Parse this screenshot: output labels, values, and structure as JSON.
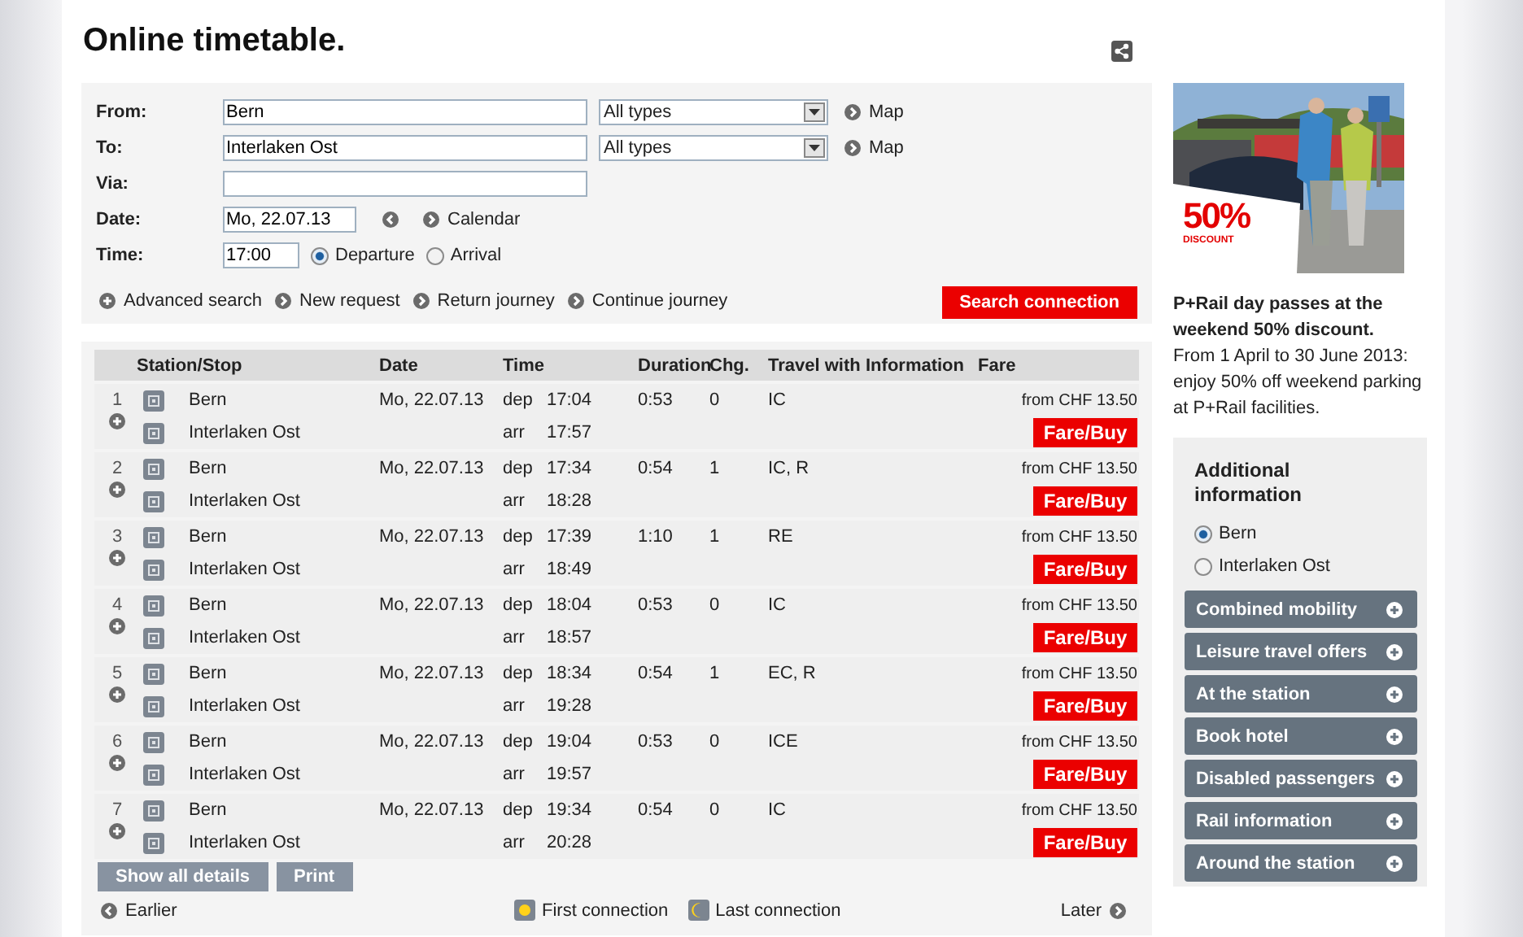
{
  "title": "Online timetable.",
  "from": {
    "label": "From:",
    "value": "Bern",
    "select": "All types",
    "map_link": "Map"
  },
  "to": {
    "label": "To:",
    "value": "Interlaken Ost",
    "select": "All types",
    "map_link": "Map"
  },
  "via": {
    "label": "Via:"
  },
  "date": {
    "label": "Date:",
    "value": "Mo, 22.07.13",
    "calendar_link": "Calendar"
  },
  "time": {
    "label": "Time:",
    "value": "17:00",
    "options": [
      {
        "label": "Departure",
        "selected": true
      },
      {
        "label": "Arrival",
        "selected": false
      }
    ]
  },
  "links": [
    "Advanced search",
    "New request",
    "Return journey",
    "Continue journey"
  ],
  "search_button": "Search connection",
  "table": {
    "columns": [
      "Station/Stop",
      "Date",
      "Time",
      "Duration",
      "Chg.",
      "Travel with",
      "Information",
      "Fare"
    ],
    "rows": [
      {
        "number": "1",
        "from": "Bern",
        "to": "Interlaken Ost",
        "date": "Mo, 22.07.13",
        "dep_label": "dep",
        "dep": "17:04",
        "arr_label": "arr",
        "arr": "17:57",
        "duration": "0:53",
        "changes": "0",
        "travel_with": "IC",
        "fare": "from CHF 13.50",
        "buy": "Fare/Buy"
      },
      {
        "number": "2",
        "from": "Bern",
        "to": "Interlaken Ost",
        "date": "Mo, 22.07.13",
        "dep_label": "dep",
        "dep": "17:34",
        "arr_label": "arr",
        "arr": "18:28",
        "duration": "0:54",
        "changes": "1",
        "travel_with": "IC, R",
        "fare": "from CHF 13.50",
        "buy": "Fare/Buy"
      },
      {
        "number": "3",
        "from": "Bern",
        "to": "Interlaken Ost",
        "date": "Mo, 22.07.13",
        "dep_label": "dep",
        "dep": "17:39",
        "arr_label": "arr",
        "arr": "18:49",
        "duration": "1:10",
        "changes": "1",
        "travel_with": "RE",
        "fare": "from CHF 13.50",
        "buy": "Fare/Buy"
      },
      {
        "number": "4",
        "from": "Bern",
        "to": "Interlaken Ost",
        "date": "Mo, 22.07.13",
        "dep_label": "dep",
        "dep": "18:04",
        "arr_label": "arr",
        "arr": "18:57",
        "duration": "0:53",
        "changes": "0",
        "travel_with": "IC",
        "fare": "from CHF 13.50",
        "buy": "Fare/Buy"
      },
      {
        "number": "5",
        "from": "Bern",
        "to": "Interlaken Ost",
        "date": "Mo, 22.07.13",
        "dep_label": "dep",
        "dep": "18:34",
        "arr_label": "arr",
        "arr": "19:28",
        "duration": "0:54",
        "changes": "1",
        "travel_with": "EC, R",
        "fare": "from CHF 13.50",
        "buy": "Fare/Buy"
      },
      {
        "number": "6",
        "from": "Bern",
        "to": "Interlaken Ost",
        "date": "Mo, 22.07.13",
        "dep_label": "dep",
        "dep": "19:04",
        "arr_label": "arr",
        "arr": "19:57",
        "duration": "0:53",
        "changes": "0",
        "travel_with": "ICE",
        "fare": "from CHF 13.50",
        "buy": "Fare/Buy"
      },
      {
        "number": "7",
        "from": "Bern",
        "to": "Interlaken Ost",
        "date": "Mo, 22.07.13",
        "dep_label": "dep",
        "dep": "19:34",
        "arr_label": "arr",
        "arr": "20:28",
        "duration": "0:54",
        "changes": "0",
        "travel_with": "IC",
        "fare": "from CHF 13.50",
        "buy": "Fare/Buy"
      }
    ]
  },
  "table_buttons": [
    "Show all details",
    "Print"
  ],
  "nav": {
    "earlier": "Earlier",
    "first": "First connection",
    "last": "Last connection",
    "later": "Later"
  },
  "promo": {
    "badge": "50%",
    "badge_sub": "DISCOUNT",
    "headline": "P+Rail day passes at the weekend 50% discount.",
    "body": "From 1 April to 30 June 2013: enjoy 50% off weekend parking at P+Rail facilities."
  },
  "additional": {
    "title": "Additional information",
    "stations": [
      {
        "label": "Bern",
        "selected": true
      },
      {
        "label": "Interlaken Ost",
        "selected": false
      }
    ],
    "items": [
      "Combined mobility",
      "Leisure travel offers",
      "At the station",
      "Book hotel",
      "Disabled passengers",
      "Rail information",
      "Around the station"
    ]
  }
}
